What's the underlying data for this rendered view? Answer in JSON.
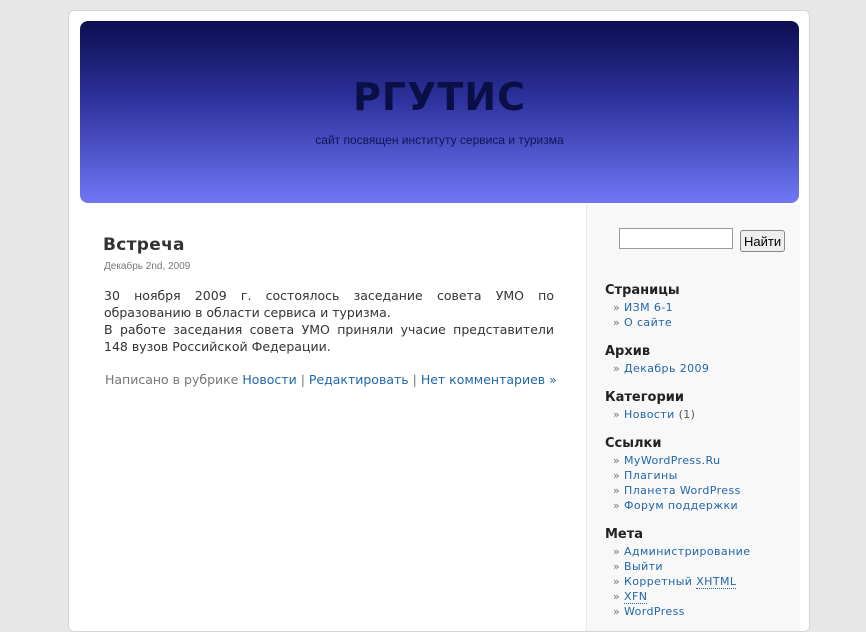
{
  "header": {
    "title": "РГУТИС",
    "description": "сайт посвящен институту сервиса и туризма"
  },
  "post": {
    "title": "Встреча",
    "date": "Декабрь 2nd, 2009",
    "paragraph1": "30 ноября 2009 г. состоялось заседание совета УМО по образованию в области сервиса и туризма.",
    "paragraph2": "В работе заседания совета УМО приняли учасие представители 148 вузов Российской Федерации.",
    "meta_prefix": "Написано в рубрике",
    "category_link": "Новости",
    "sep": "|",
    "edit_link": "Редактировать",
    "comments_link": "Нет комментариев »"
  },
  "search": {
    "value": "",
    "button_label": "Найти"
  },
  "sidebar": {
    "pages": {
      "heading": "Страницы",
      "items": [
        "ИЗМ 6-1",
        "О сайте"
      ]
    },
    "archive": {
      "heading": "Архив",
      "items": [
        "Декабрь 2009"
      ]
    },
    "categories": {
      "heading": "Категории",
      "items": [
        {
          "label": "Новости",
          "count": "(1)"
        }
      ]
    },
    "links": {
      "heading": "Ссылки",
      "items": [
        "MyWordPress.Ru",
        "Плагины",
        "Планета WordPress",
        "Форум поддержки"
      ]
    },
    "meta": {
      "heading": "Мета",
      "items": [
        "Администрирование",
        "Выйти",
        "Корретный ",
        "XHTML",
        "XFN",
        "WordPress"
      ]
    }
  },
  "colors": {
    "background": "#e7e7e7",
    "header_top": "#0b0e50",
    "header_bottom": "#6f77f5",
    "link": "#2266aa"
  }
}
